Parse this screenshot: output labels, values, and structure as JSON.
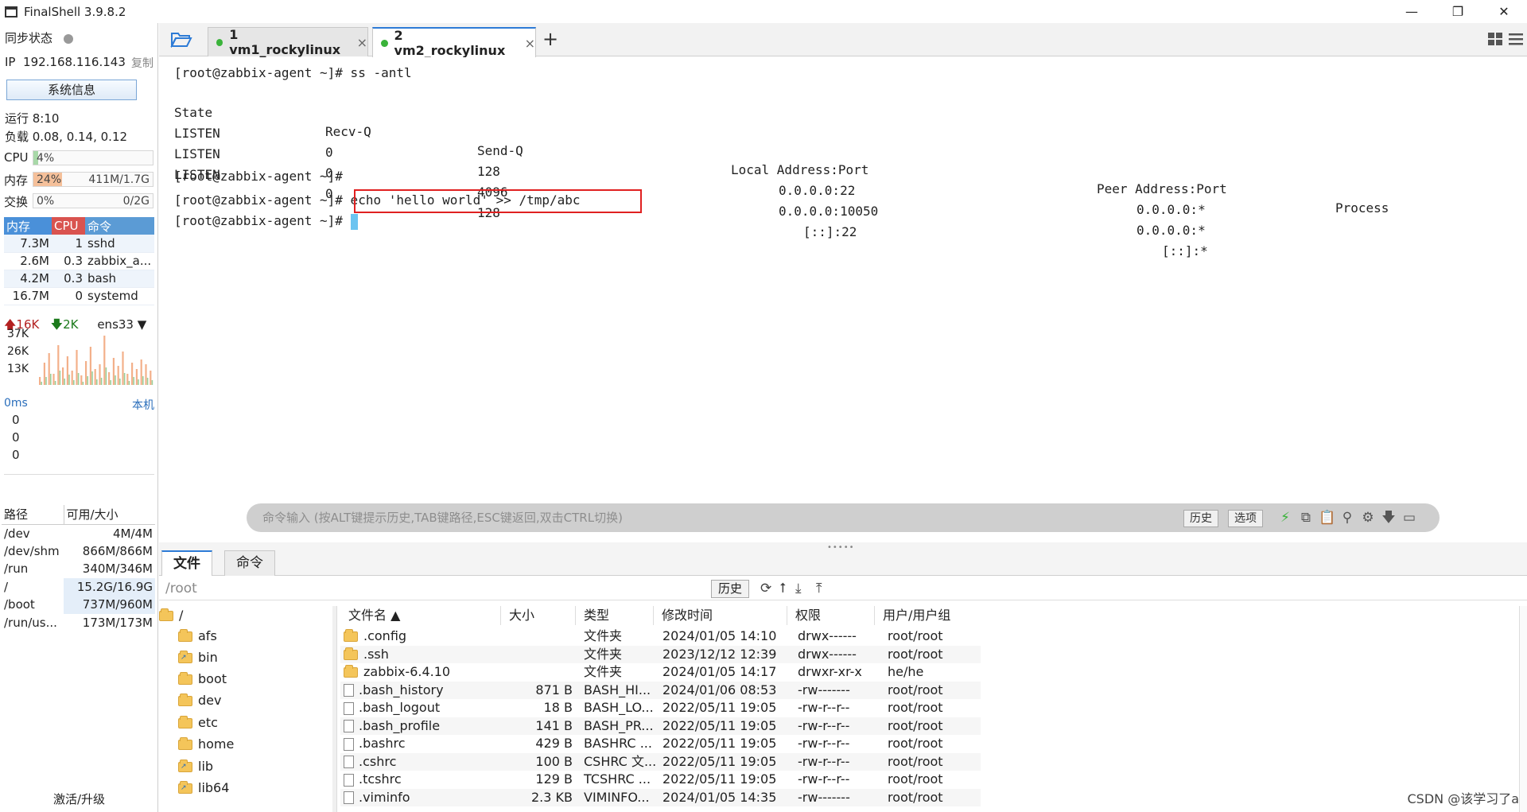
{
  "window": {
    "title": "FinalShell 3.9.8.2",
    "controls": [
      "—",
      "❐",
      "✕"
    ]
  },
  "sidebar": {
    "sync_label": "同步状态",
    "ip_label": "IP",
    "ip": "192.168.116.143",
    "copy_label": "复制",
    "sysinfo_button": "系统信息",
    "uptime": "运行 8:10",
    "load": "负载 0.08, 0.14, 0.12",
    "cpu": {
      "label": "CPU",
      "percent_text": "4%",
      "fraction": 0.04
    },
    "memory": {
      "label": "内存",
      "percent_text": "24%",
      "usage": "411M/1.7G",
      "fraction": 0.24
    },
    "swap": {
      "label": "交换",
      "percent_text": "0%",
      "usage": "0/2G",
      "fraction": 0.0
    },
    "process_table": {
      "headers": [
        "内存",
        "CPU",
        "命令"
      ],
      "rows": [
        [
          "7.3M",
          "1",
          "sshd"
        ],
        [
          "2.6M",
          "0.3",
          "zabbix_a..."
        ],
        [
          "4.2M",
          "0.3",
          "bash"
        ],
        [
          "16.7M",
          "0",
          "systemd"
        ]
      ]
    },
    "network": {
      "up": "16K",
      "down": "2K",
      "interface": "ens33",
      "ticks": [
        "37K",
        "26K",
        "13K"
      ]
    },
    "latency": {
      "value": "0ms",
      "target": "本机",
      "values": [
        "0",
        "0",
        "0"
      ]
    },
    "disk_table": {
      "headers": [
        "路径",
        "可用/大小"
      ],
      "rows": [
        [
          "/dev",
          "4M/4M"
        ],
        [
          "/dev/shm",
          "866M/866M"
        ],
        [
          "/run",
          "340M/346M"
        ],
        [
          "/",
          "15.2G/16.9G"
        ],
        [
          "/boot",
          "737M/960M"
        ],
        [
          "/run/us...",
          "173M/173M"
        ]
      ]
    },
    "activate_label": "激活/升级"
  },
  "tabs": [
    {
      "label": "1 vm1_rockylinux",
      "active": false
    },
    {
      "label": "2 vm2_rockylinux",
      "active": true
    }
  ],
  "tab_close": "×",
  "add_tab": "+",
  "terminal": {
    "prompt": "[root@zabbix-agent ~]#",
    "lines": [
      {
        "prompt": "[root@zabbix-agent ~]#",
        "cmd": " ss -antl"
      },
      {
        "prompt": "[root@zabbix-agent ~]#",
        "cmd": ""
      },
      {
        "prompt": "[root@zabbix-agent ~]#",
        "cmd": " echo 'hello world' >> /tmp/abc"
      },
      {
        "prompt": "[root@zabbix-agent ~]#",
        "cmd": " "
      }
    ],
    "ss_headers": [
      "State",
      "Recv-Q",
      "Send-Q",
      "Local Address:Port",
      "Peer Address:Port",
      "Process"
    ],
    "ss_rows": [
      [
        "LISTEN",
        "0",
        "128",
        "0.0.0.0:22",
        "0.0.0.0:*"
      ],
      [
        "LISTEN",
        "0",
        "4096",
        "0.0.0.0:10050",
        "0.0.0.0:*"
      ],
      [
        "LISTEN",
        "0",
        "128",
        "[::]:22",
        "[::]:*"
      ]
    ]
  },
  "command_bar": {
    "placeholder": "命令输入 (按ALT键提示历史,TAB键路径,ESC键返回,双击CTRL切换)",
    "history_button": "历史",
    "options_button": "选项"
  },
  "file_panel": {
    "tabs": [
      "文件",
      "命令"
    ],
    "path": "/root",
    "history_button": "历史",
    "tree": [
      "/",
      "afs",
      "bin",
      "boot",
      "dev",
      "etc",
      "home",
      "lib",
      "lib64"
    ],
    "columns": [
      "文件名 ▲",
      "大小",
      "类型",
      "修改时间",
      "权限",
      "用户/用户组"
    ],
    "files": [
      {
        "name": ".config",
        "size": "",
        "type": "文件夹",
        "mtime": "2024/01/05 14:10",
        "perm": "drwx------",
        "owner": "root/root",
        "folder": true
      },
      {
        "name": ".ssh",
        "size": "",
        "type": "文件夹",
        "mtime": "2023/12/12 12:39",
        "perm": "drwx------",
        "owner": "root/root",
        "folder": true
      },
      {
        "name": "zabbix-6.4.10",
        "size": "",
        "type": "文件夹",
        "mtime": "2024/01/05 14:17",
        "perm": "drwxr-xr-x",
        "owner": "he/he",
        "folder": true
      },
      {
        "name": ".bash_history",
        "size": "871 B",
        "type": "BASH_HI...",
        "mtime": "2024/01/06 08:53",
        "perm": "-rw-------",
        "owner": "root/root",
        "folder": false
      },
      {
        "name": ".bash_logout",
        "size": "18 B",
        "type": "BASH_LO...",
        "mtime": "2022/05/11 19:05",
        "perm": "-rw-r--r--",
        "owner": "root/root",
        "folder": false
      },
      {
        "name": ".bash_profile",
        "size": "141 B",
        "type": "BASH_PR...",
        "mtime": "2022/05/11 19:05",
        "perm": "-rw-r--r--",
        "owner": "root/root",
        "folder": false
      },
      {
        "name": ".bashrc",
        "size": "429 B",
        "type": "BASHRC ...",
        "mtime": "2022/05/11 19:05",
        "perm": "-rw-r--r--",
        "owner": "root/root",
        "folder": false
      },
      {
        "name": ".cshrc",
        "size": "100 B",
        "type": "CSHRC 文...",
        "mtime": "2022/05/11 19:05",
        "perm": "-rw-r--r--",
        "owner": "root/root",
        "folder": false
      },
      {
        "name": ".tcshrc",
        "size": "129 B",
        "type": "TCSHRC ...",
        "mtime": "2022/05/11 19:05",
        "perm": "-rw-r--r--",
        "owner": "root/root",
        "folder": false
      },
      {
        "name": ".viminfo",
        "size": "2.3 KB",
        "type": "VIMINFO...",
        "mtime": "2024/01/05 14:35",
        "perm": "-rw-------",
        "owner": "root/root",
        "folder": false
      }
    ]
  },
  "watermark": "CSDN @该学习了a",
  "colors": {
    "accent": "#2d7bd6",
    "mem_header": "#4a90d9",
    "cpu_header": "#d9534f",
    "cmd_header": "#5b9bd5",
    "highlight_box": "#e02020",
    "cursor": "#6cc4f0",
    "cpu_fill": "#a8d8a8",
    "mem_fill": "#f5c09a"
  },
  "icons": [
    "folder-open-icon",
    "grid-icon",
    "menu-icon",
    "lightning-icon",
    "copy-icon",
    "paste-icon",
    "search-icon",
    "gear-icon",
    "arrow-down-icon",
    "window-icon",
    "refresh-icon",
    "up-icon",
    "download-icon",
    "upload-icon",
    "sort-asc-icon",
    "dropdown-icon"
  ]
}
